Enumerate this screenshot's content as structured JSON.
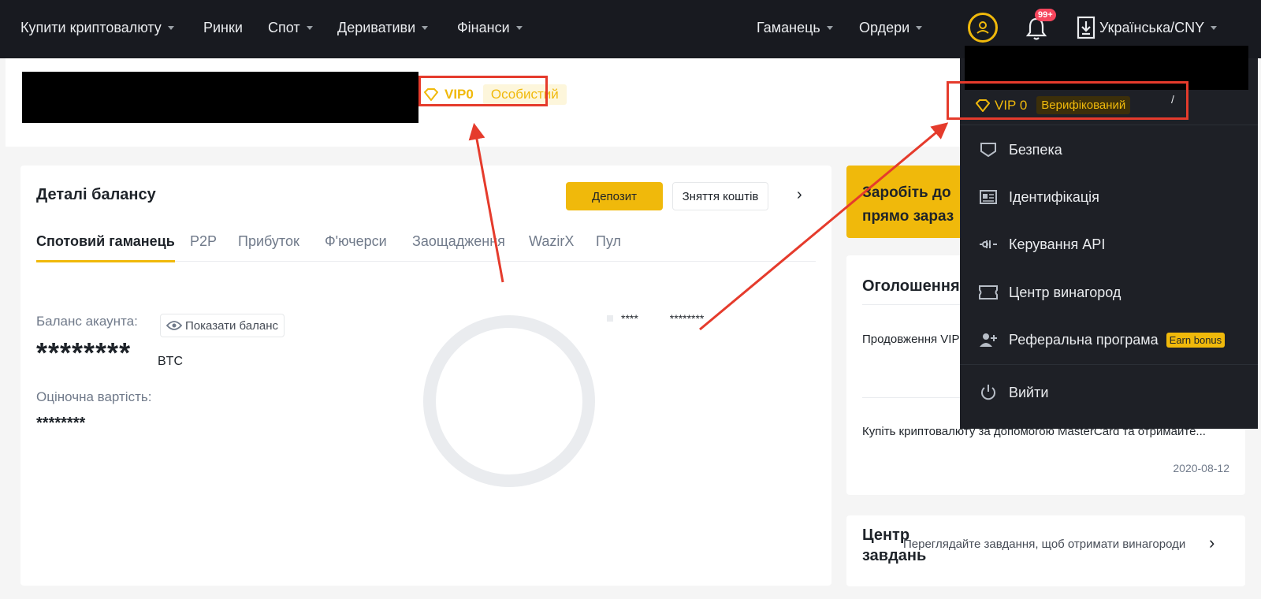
{
  "nav": {
    "items": [
      {
        "label": "Купити криптовалюту",
        "caret": true
      },
      {
        "label": "Ринки",
        "caret": false
      },
      {
        "label": "Спот",
        "caret": true
      },
      {
        "label": "Деривативи",
        "caret": true
      },
      {
        "label": "Фінанси",
        "caret": true
      }
    ],
    "right_items": [
      {
        "label": "Гаманець",
        "caret": true
      },
      {
        "label": "Ордери",
        "caret": true
      }
    ],
    "notification_badge": "99+",
    "language": "Українська/CNY",
    "icons": [
      "user-icon",
      "bell-icon",
      "download-icon"
    ]
  },
  "header": {
    "vip_label": "VIP0",
    "vip_status": "Особистий"
  },
  "balance": {
    "title": "Деталі балансу",
    "deposit_label": "Депозит",
    "withdraw_label": "Зняття коштів",
    "tabs": [
      "Спотовий гаманець",
      "P2P",
      "Прибуток",
      "Ф'ючерси",
      "Заощадження",
      "WazirX",
      "Пул"
    ],
    "active_tab": "Спотовий гаманець",
    "account_balance_label": "Баланс акаунта:",
    "show_balance_label": "Показати баланс",
    "hidden_balance": "********",
    "currency": "BTC",
    "estimated_label": "Оціночна вартість:",
    "hidden_estimate": "********",
    "legend_name": "****",
    "legend_value": "********"
  },
  "promo": {
    "line1": "Заробіть до",
    "line2": "прямо зараз"
  },
  "announcements": {
    "title": "Оголошення",
    "items": [
      {
        "text": "Продовження VIP"
      },
      {
        "text": "Купіть криптовалюту за допомогою MasterCard та отримайте..."
      }
    ],
    "date": "2020-08-12"
  },
  "tasks": {
    "title_line1": "Центр",
    "title_line2": "завдань",
    "subtitle": "Переглядайте завдання, щоб отримати винагороди"
  },
  "dropdown": {
    "vip_label": "VIP 0",
    "verified_label": "Верифікований",
    "items": [
      {
        "label": "Безпека",
        "icon": "shield-icon"
      },
      {
        "label": "Ідентифікація",
        "icon": "id-card-icon"
      },
      {
        "label": "Керування API",
        "icon": "api-icon"
      },
      {
        "label": "Центр винагород",
        "icon": "ticket-icon"
      },
      {
        "label": "Реферальна програма",
        "icon": "add-user-icon"
      }
    ],
    "earn_bonus": "Earn bonus",
    "logout_label": "Вийти"
  },
  "colors": {
    "accent": "#f0b90b",
    "nav_bg": "#181a20",
    "annotation": "#e53b2c"
  }
}
